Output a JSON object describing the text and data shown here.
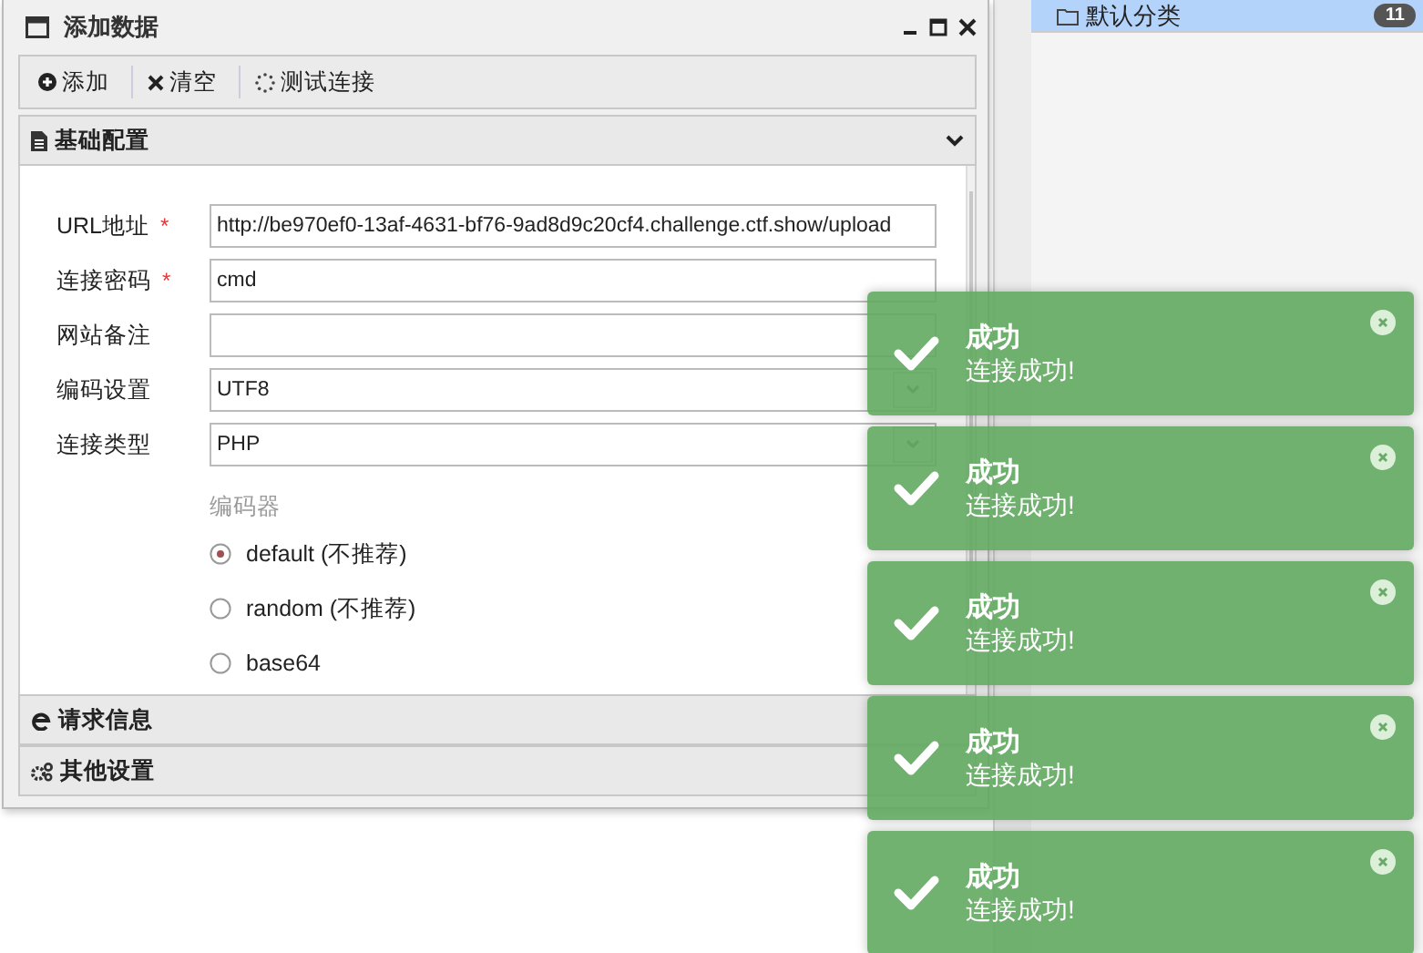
{
  "window": {
    "title": "添加数据"
  },
  "toolbar": [
    {
      "label": "添加",
      "kind": "add"
    },
    {
      "label": "清空",
      "kind": "clear"
    },
    {
      "label": "测试连接",
      "kind": "test"
    }
  ],
  "sections": [
    {
      "title": "基础配置",
      "kind": "file",
      "expanded": true
    },
    {
      "title": "请求信息",
      "kind": "request",
      "expanded": false
    },
    {
      "title": "其他设置",
      "kind": "gears",
      "expanded": false
    }
  ],
  "fields": [
    {
      "label": "URL地址",
      "required_mark": "*",
      "kind": "text",
      "value": "http://be970ef0-13af-4631-bf76-9ad8d9c20cf4.challenge.ctf.show/upload"
    },
    {
      "label": "连接密码",
      "required_mark": "*",
      "kind": "text",
      "value": "cmd"
    },
    {
      "label": "网站备注",
      "kind": "text"
    },
    {
      "label": "编码设置",
      "kind": "select",
      "value": "UTF8"
    },
    {
      "label": "连接类型",
      "kind": "select",
      "value": "PHP"
    }
  ],
  "encoder": {
    "label": "编码器",
    "options": [
      {
        "label": "default (不推荐)",
        "selected": true
      },
      {
        "label": "random (不推荐)",
        "selected": false
      },
      {
        "label": "base64",
        "selected": false
      }
    ]
  },
  "category": {
    "label": "默认分类",
    "count": "11",
    "selected": true
  },
  "toasts": [
    {
      "title": "成功",
      "message": "连接成功!"
    },
    {
      "title": "成功",
      "message": "连接成功!"
    },
    {
      "title": "成功",
      "message": "连接成功!"
    },
    {
      "title": "成功",
      "message": "连接成功!"
    },
    {
      "title": "成功",
      "message": "连接成功!"
    }
  ]
}
